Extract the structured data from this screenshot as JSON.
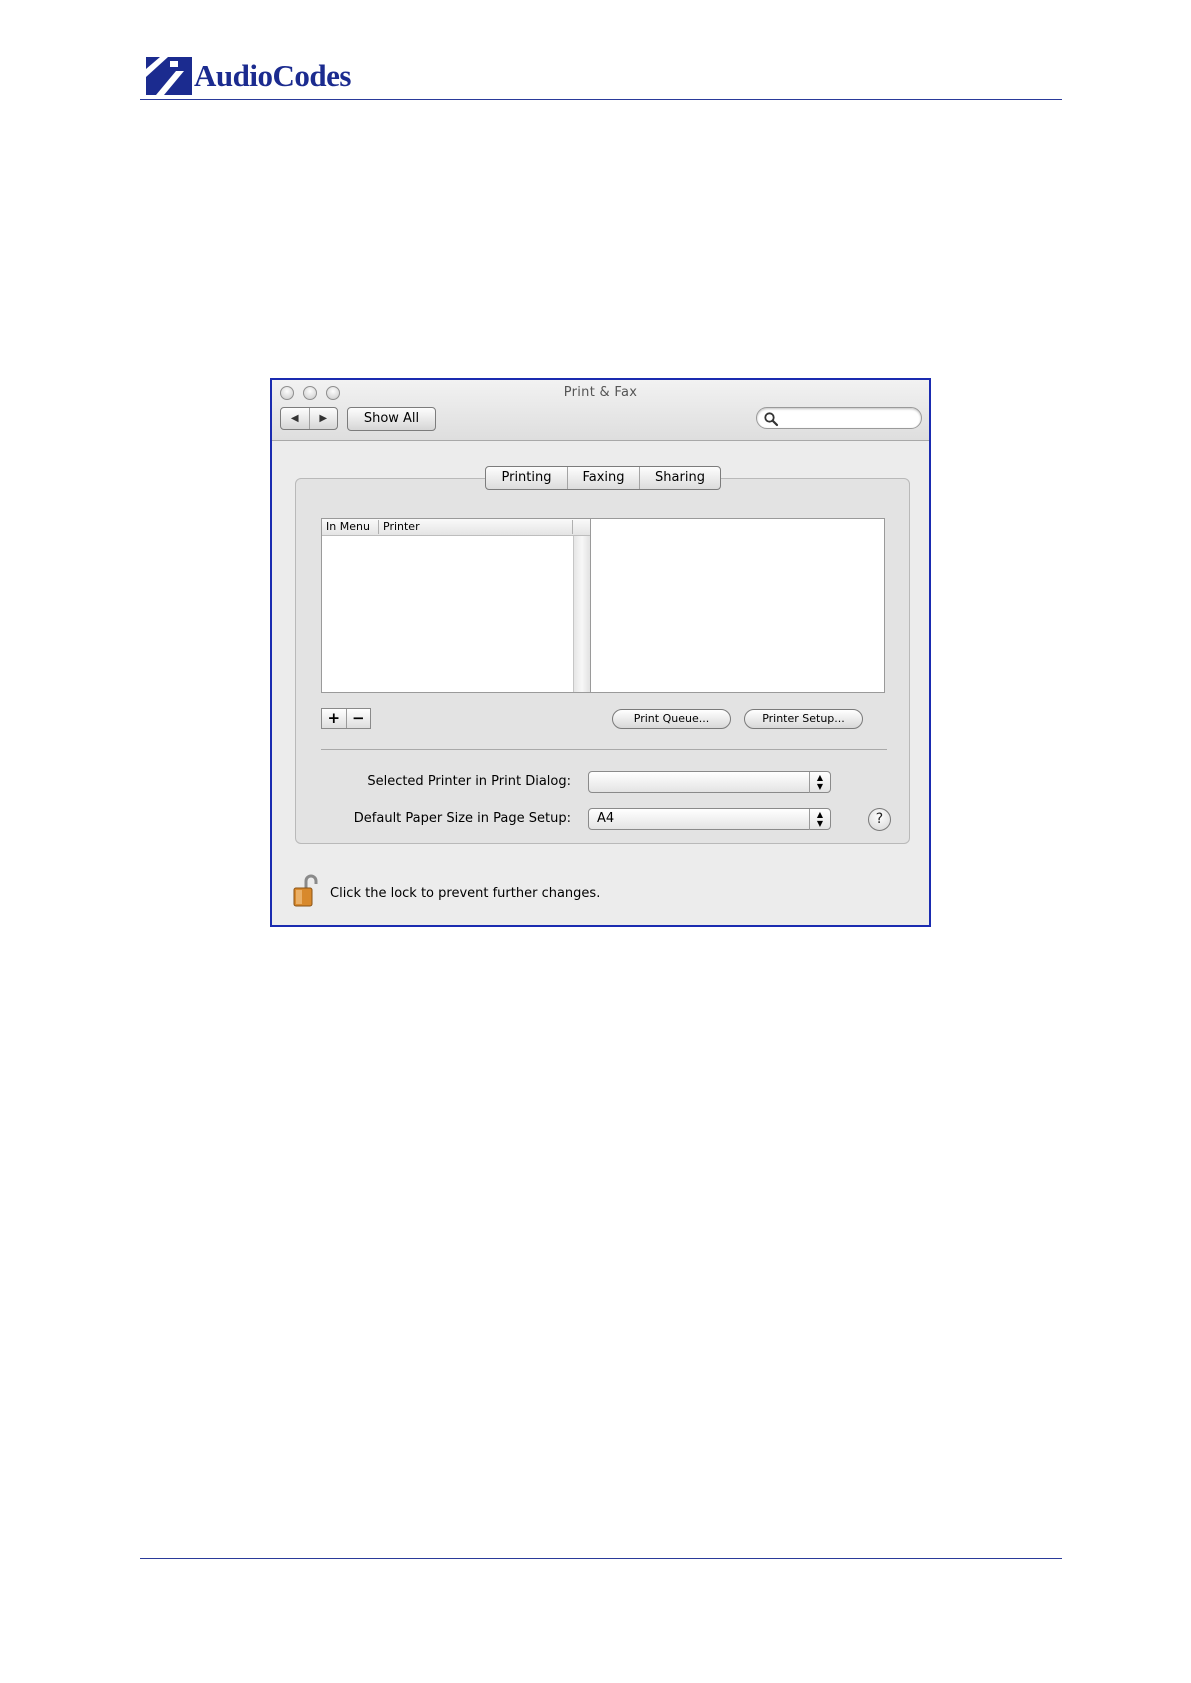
{
  "header": {
    "brand": "AudioCodes",
    "rule_color": "#2a3a9a",
    "brand_color": "#1b2b8f"
  },
  "window": {
    "title": "Print & Fax",
    "traffic_lights": [
      "close-button",
      "minimize-button",
      "zoom-button"
    ],
    "toolbar": {
      "back_icon": "left-arrow-icon",
      "forward_icon": "right-arrow-icon",
      "show_all_label": "Show All",
      "search_icon": "magnifier-icon",
      "search_value": ""
    },
    "tabs": [
      {
        "label": "Printing",
        "selected": true
      },
      {
        "label": "Faxing",
        "selected": false
      },
      {
        "label": "Sharing",
        "selected": false
      }
    ],
    "printer_list": {
      "columns": [
        "In Menu",
        "Printer"
      ],
      "rows": []
    },
    "list_controls": {
      "add_label": "+",
      "remove_label": "−"
    },
    "buttons": {
      "print_queue": "Print Queue...",
      "printer_setup": "Printer Setup..."
    },
    "fields": {
      "selected_printer_label": "Selected Printer in Print Dialog:",
      "selected_printer_value": "",
      "paper_size_label": "Default Paper Size in Page Setup:",
      "paper_size_value": "A4"
    },
    "help_label": "?",
    "lock": {
      "icon": "open-lock-icon",
      "text": "Click the lock to prevent further changes."
    },
    "border_color": "#1a2bb0"
  }
}
